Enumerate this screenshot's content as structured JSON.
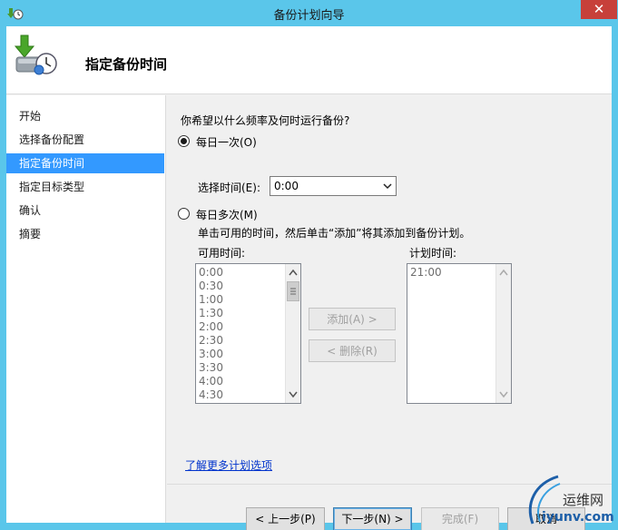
{
  "window": {
    "title": "备份计划向导",
    "close_glyph": "✕"
  },
  "header": {
    "title": "指定备份时间"
  },
  "sidebar": {
    "items": [
      {
        "label": "开始"
      },
      {
        "label": "选择备份配置"
      },
      {
        "label": "指定备份时间"
      },
      {
        "label": "指定目标类型"
      },
      {
        "label": "确认"
      },
      {
        "label": "摘要"
      }
    ],
    "active_index": 2
  },
  "schedule": {
    "question": "你希望以什么频率及何时运行备份?",
    "once_daily_label": "每日一次(O)",
    "time_label": "选择时间(E):",
    "time_value": "0:00",
    "multi_daily_label": "每日多次(M)",
    "multi_instruction": "单击可用的时间，然后单击“添加”将其添加到备份计划。",
    "available_label": "可用时间:",
    "scheduled_label": "计划时间:",
    "available_times": [
      "0:00",
      "0:30",
      "1:00",
      "1:30",
      "2:00",
      "2:30",
      "3:00",
      "3:30",
      "4:00",
      "4:30"
    ],
    "scheduled_times": [
      "21:00"
    ],
    "add_button": "添加(A) >",
    "remove_button": "< 删除(R)",
    "learn_more_link": "了解更多计划选项"
  },
  "footer": {
    "back_button": "< 上一步(P)",
    "next_button": "下一步(N) >",
    "finish_button": "完成(F)",
    "cancel_button": "取消"
  },
  "watermark": {
    "cn_text": "运维网",
    "en_text": "iyunv.com"
  },
  "colors": {
    "titlebar": "#5ac6ea",
    "selected_nav": "#3399ff",
    "close_button": "#c7403a",
    "link": "#0033cc"
  }
}
